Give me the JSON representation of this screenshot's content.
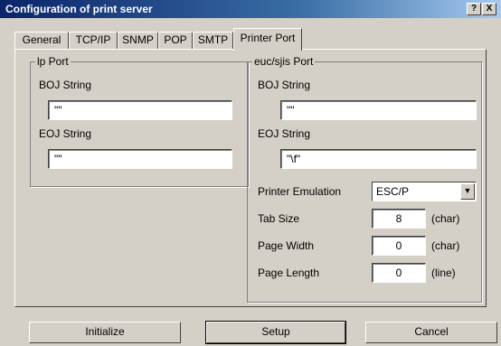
{
  "window": {
    "title": "Configuration of print server",
    "help_label": "?",
    "close_label": "X"
  },
  "tabs": [
    {
      "label": "General"
    },
    {
      "label": "TCP/IP"
    },
    {
      "label": "SNMP"
    },
    {
      "label": "POP"
    },
    {
      "label": "SMTP"
    },
    {
      "label": "Printer Port",
      "active": true
    }
  ],
  "lp_port": {
    "legend": "lp Port",
    "boj_label": "BOJ String",
    "boj_value": "\"\"",
    "eoj_label": "EOJ String",
    "eoj_value": "\"\""
  },
  "euc_port": {
    "legend": "euc/sjis Port",
    "boj_label": "BOJ String",
    "boj_value": "\"\"",
    "eoj_label": "EOJ String",
    "eoj_value": "\"\\f\"",
    "emulation_label": "Printer Emulation",
    "emulation_value": "ESC/P",
    "tab_size_label": "Tab Size",
    "tab_size_value": "8",
    "tab_size_unit": "(char)",
    "page_width_label": "Page Width",
    "page_width_value": "0",
    "page_width_unit": "(char)",
    "page_length_label": "Page Length",
    "page_length_value": "0",
    "page_length_unit": "(line)"
  },
  "buttons": {
    "initialize": "Initialize",
    "setup": "Setup",
    "cancel": "Cancel"
  }
}
